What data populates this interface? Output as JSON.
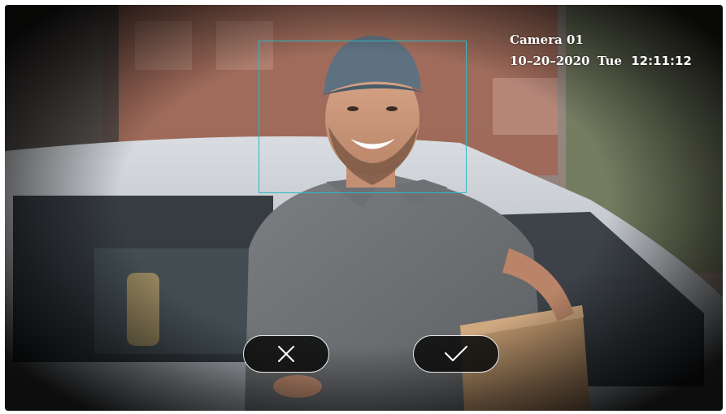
{
  "overlay": {
    "camera_name": "Camera 01",
    "date": "10–20–2020",
    "weekday": "Tue",
    "time": "12:11:12"
  },
  "colors": {
    "face_box": "#2fb7c6",
    "button_bg": "#0c0c0c",
    "button_border": "#e6e6e6",
    "overlay_text": "#ffffff"
  },
  "controls": {
    "reject_icon": "close-icon",
    "accept_icon": "checkmark-icon"
  }
}
